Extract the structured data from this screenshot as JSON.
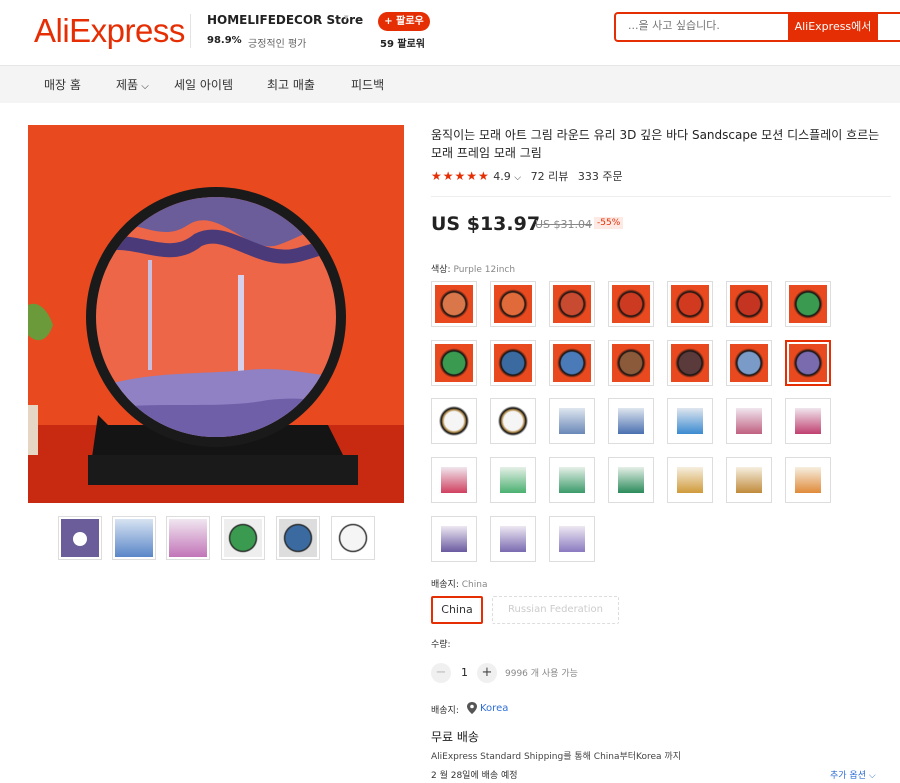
{
  "header": {
    "logo": "AliExpress",
    "store_name": "HOMELIFEDECOR Store",
    "feedback_pct": "98.9%",
    "feedback_label": "긍정적인 평가",
    "follow_label": "+ 팔로우",
    "followers": "59 팔로워",
    "search_placeholder": "...을 사고 싶습니다.",
    "search_button": "AliExpress에서"
  },
  "nav": {
    "items": [
      "매장 홈",
      "제품",
      "세일 아이템",
      "최고 매출",
      "피드백"
    ]
  },
  "product": {
    "title": "움직이는 모래 아트 그림 라운드 유리 3D 깊은 바다 Sandscape 모션 디스플레이 흐르는 모래 프레임 모래 그림",
    "rating": "4.9",
    "reviews": "72 리뷰",
    "orders": "333 주문",
    "price": "US $13.97",
    "original_price": "US $31.04",
    "discount": "-55%",
    "color_label": "색상:",
    "color_value": "Purple 12inch",
    "ship_from_label": "배송지:",
    "ship_from_value": "China",
    "ship_from_options": [
      "China",
      "Russian Federation"
    ],
    "quantity_label": "수량:",
    "quantity": "1",
    "available": "9996 개 사용 가능",
    "ship_to_label": "배송지:",
    "ship_to_value": "Korea",
    "free_shipping": "무료 배송",
    "shipping_desc": "AliExpress Standard Shipping를 통해 China부터Korea 까지",
    "delivery": "2 월 28일에 배송 예정",
    "more_options": "추가 옵션"
  },
  "colors": {
    "accent": "#e62e04",
    "link": "#2e6fd6",
    "swatch_orange": "#e8491e"
  }
}
